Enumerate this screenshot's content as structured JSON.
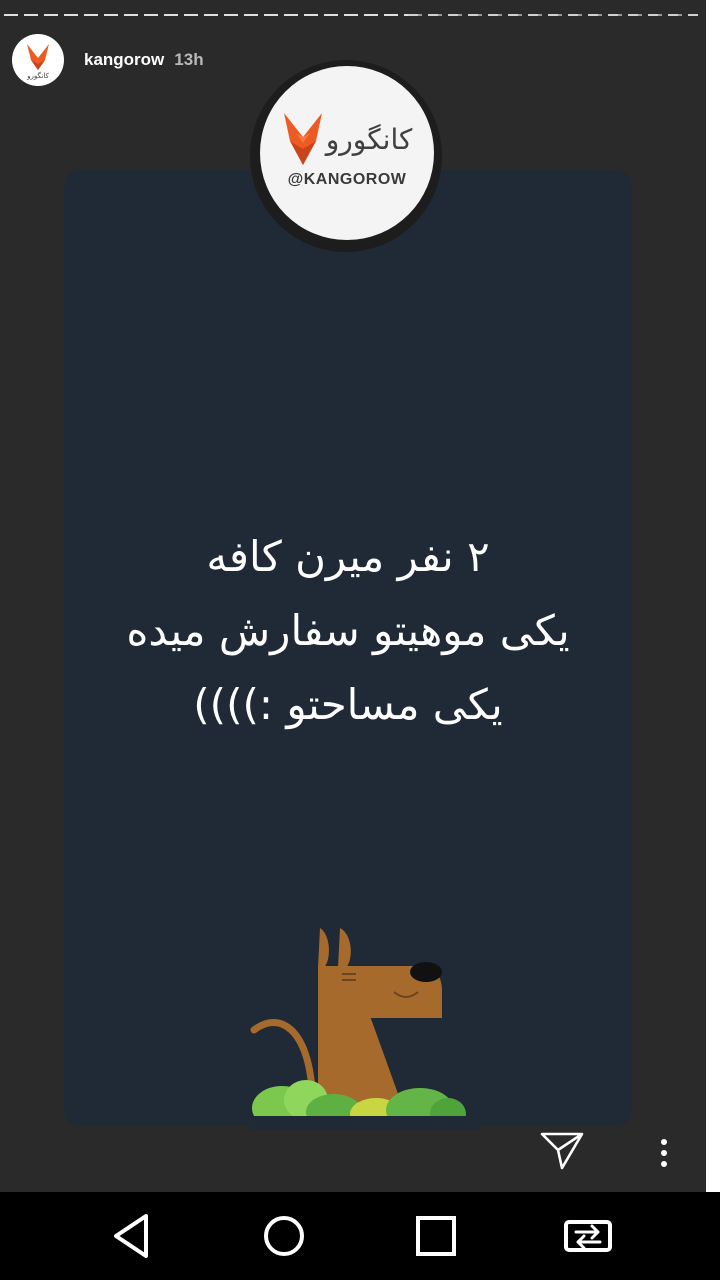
{
  "story": {
    "username": "kangorow",
    "time_ago": "13h",
    "avatar_icon": "kangorow-logo-icon"
  },
  "logo": {
    "brand_fa": "کانگورو",
    "handle": "@KANGOROW"
  },
  "message_lines": [
    "۲ نفر میرن کافه",
    "یکی موهیتو سفارش میده",
    "یکی مساحتو :))))"
  ],
  "actions": {
    "send_icon": "send-icon",
    "more_icon": "more-vertical-icon"
  },
  "navbar": {
    "back_icon": "back-triangle-icon",
    "home_icon": "home-circle-icon",
    "recents_icon": "recents-square-icon",
    "switch_icon": "switch-apps-icon"
  },
  "colors": {
    "background": "#2a2a2b",
    "card": "#1f2a36",
    "brand_orange": "#ee5a24",
    "dog_brown": "#a56a2c",
    "bush_green": "#7cc84e"
  }
}
